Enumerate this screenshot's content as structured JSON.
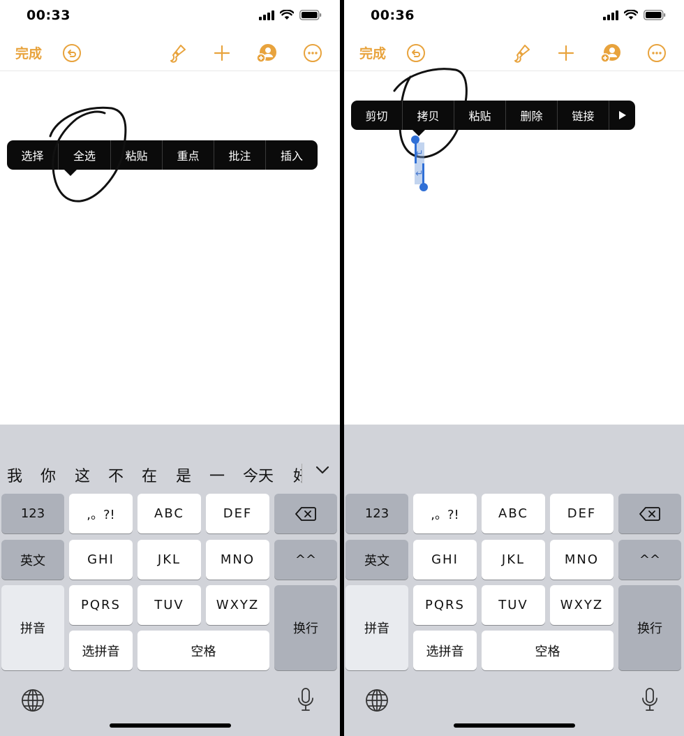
{
  "left": {
    "status_time": "00:33",
    "toolbar": {
      "done_label": "完成"
    },
    "context_menu": [
      "选择",
      "全选",
      "粘贴",
      "重点",
      "批注",
      "插入"
    ],
    "candidates": [
      "我",
      "你",
      "这",
      "不",
      "在",
      "是",
      "一",
      "今天",
      "好"
    ]
  },
  "right": {
    "status_time": "00:36",
    "toolbar": {
      "done_label": "完成"
    },
    "context_menu": [
      "剪切",
      "拷贝",
      "粘贴",
      "删除",
      "链接"
    ]
  },
  "keyboard": {
    "k_123": "123",
    "k_punct": ",。?!",
    "k_abc": "ABC",
    "k_def": "DEF",
    "k_english": "英文",
    "k_ghi": "GHI",
    "k_jkl": "JKL",
    "k_mno": "MNO",
    "k_emoji": "^^",
    "k_pinyin": "拼音",
    "k_pqrs": "PQRS",
    "k_tuv": "TUV",
    "k_wxyz": "WXYZ",
    "k_return": "换行",
    "k_select_pinyin": "选拼音",
    "k_space": "空格"
  },
  "colors": {
    "accent": "#E8A33D",
    "selection": "#2f6fd6"
  },
  "icons": [
    "undo-icon",
    "paintbrush-icon",
    "plus-icon",
    "collaborate-icon",
    "more-icon",
    "globe-icon",
    "microphone-icon",
    "delete-key-icon",
    "chevron-down-icon",
    "play-more-icon"
  ]
}
